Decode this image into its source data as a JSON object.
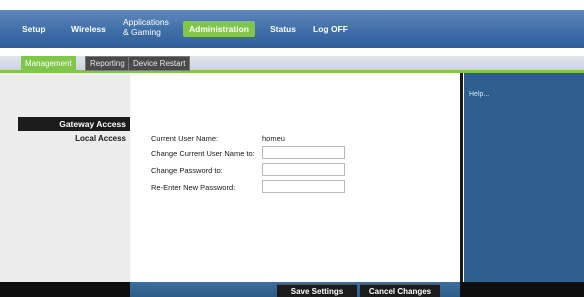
{
  "nav": {
    "items": [
      {
        "label": "Setup"
      },
      {
        "label": "Wireless"
      },
      {
        "label_line1": "Applications",
        "label_line2": "& Gaming"
      },
      {
        "label": "Administration",
        "active": true
      },
      {
        "label": "Status"
      },
      {
        "label": "Log OFF"
      }
    ]
  },
  "subnav": {
    "tabs": [
      {
        "label": "Management",
        "active": true
      },
      {
        "label": "Reporting"
      },
      {
        "label": "Device Restart"
      }
    ]
  },
  "sidebar": {
    "section": "Gateway Access",
    "items": [
      {
        "label": "Local Access"
      }
    ]
  },
  "form": {
    "current_user_label": "Current User Name:",
    "current_user_value": "homeu",
    "change_user_label": "Change Current User Name to:",
    "change_password_label": "Change Password to:",
    "reenter_password_label": "Re-Enter New Password:"
  },
  "help": {
    "text": "Help..."
  },
  "footer": {
    "save_label": "Save Settings",
    "cancel_label": "Cancel Changes"
  },
  "colors": {
    "accent_green": "#7fc64a",
    "nav_blue": "#3f6ea8",
    "help_blue": "#2e5f8e"
  }
}
